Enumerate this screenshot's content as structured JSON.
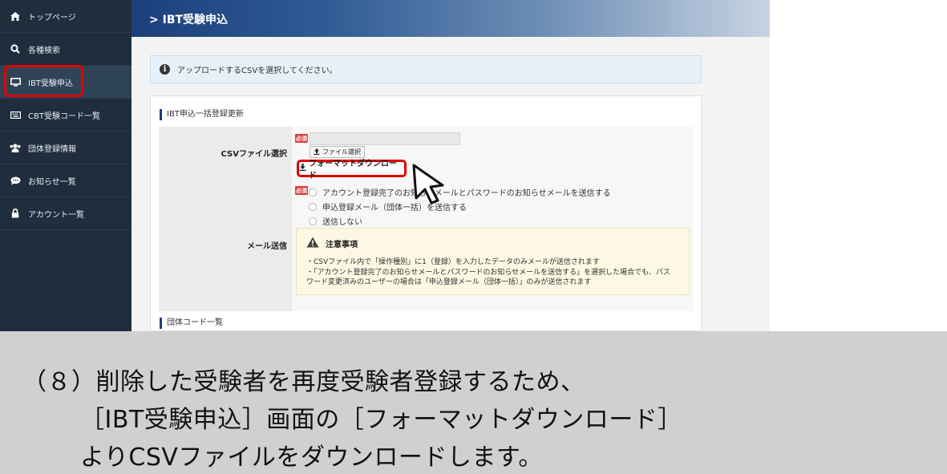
{
  "sidebar": {
    "items": [
      {
        "label": "トップページ",
        "icon": "home-icon"
      },
      {
        "label": "各種検索",
        "icon": "search-icon"
      },
      {
        "label": "IBT受験申込",
        "icon": "monitor-icon"
      },
      {
        "label": "CBT受験コード一覧",
        "icon": "keyboard-icon"
      },
      {
        "label": "団体登録情報",
        "icon": "users-icon"
      },
      {
        "label": "お知らせ一覧",
        "icon": "chat-icon"
      },
      {
        "label": "アカウント一覧",
        "icon": "lock-icon"
      }
    ],
    "active_index": 2
  },
  "header": {
    "title": "IBT受験申込",
    "chevron": ">"
  },
  "info": {
    "text": "アップロードするCSVを選択してください。"
  },
  "form": {
    "section_title": "IBT申込一括登録更新",
    "csv": {
      "label": "CSVファイル選択",
      "required": "必須",
      "file_button": "ファイル選択",
      "format_button": "フォーマットダウンロード"
    },
    "mail": {
      "label": "メール送信",
      "required": "必須",
      "options": [
        "アカウント登録完了のお知らせメールとパスワードのお知らせメールを送信する",
        "申込登録メール（団体一括）を送信する",
        "送信しない"
      ],
      "notice_title": "注意事項",
      "notice_lines": [
        "・CSVファイル内で「操作種別」に1（登録）を入力したデータのみメールが送信されます",
        "・「アカウント登録完了のお知らせメールとパスワードのお知らせメールを送信する」を選択した場合でも、パス",
        "ワード変更済みのユーザーの場合は「申込登録メール（団体一括）」のみが送信されます"
      ]
    },
    "next_section_title": "団体コード一覧"
  },
  "caption": {
    "line1": "（８）削除した受験者を再度受験者登録するため、",
    "line2": "［IBT受験申込］画面の［フォーマットダウンロード］",
    "line3": "よりCSVファイルをダウンロードします。"
  },
  "colors": {
    "sidebar_bg": "#1f2d3d",
    "header_blue": "#1c3f7a",
    "highlight_red": "#e00000",
    "required_red": "#e03a3a",
    "caption_bg": "#d0d0d0"
  }
}
